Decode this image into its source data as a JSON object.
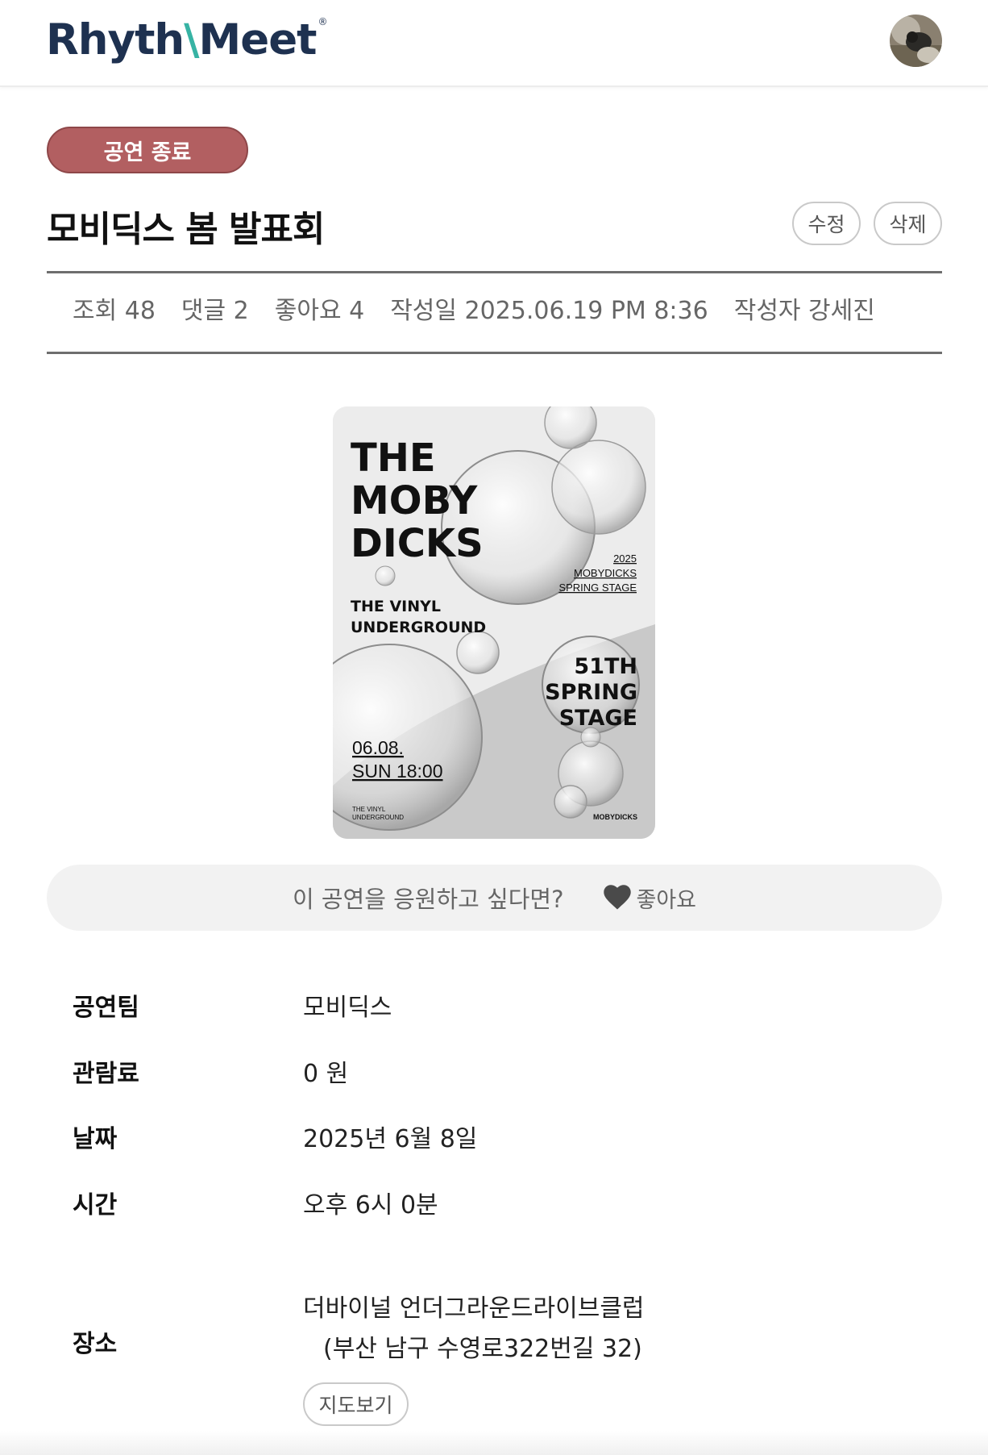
{
  "header": {
    "logo_main": "Rhyth",
    "logo_accent": "⨚",
    "logo_tail": "eet",
    "logo_reg": "®"
  },
  "post": {
    "status": "공연 종료",
    "title": "모비딕스 봄 발표회",
    "edit_label": "수정",
    "delete_label": "삭제",
    "meta": {
      "views": "조회 48",
      "comments": "댓글 2",
      "likes": "좋아요 4",
      "date": "작성일 2025.06.19 PM 8:36",
      "author": "작성자 강세진"
    }
  },
  "poster": {
    "title_line1": "THE",
    "title_line2": "MOBY",
    "title_line3": "DICKS",
    "sub_year": "2025",
    "sub_name": "MOBYDICKS",
    "sub_stage": "SPRING STAGE",
    "venue_line1": "THE VINYL",
    "venue_line2": "UNDERGROUND",
    "event_line1": "51TH",
    "event_line2": "SPRING",
    "event_line3": "STAGE",
    "date_line1": "06.08.",
    "date_line2": "SUN 18:00",
    "footer_left1": "THE VINYL",
    "footer_left2": "UNDERGROUND",
    "footer_right": "MOBYDICKS"
  },
  "like_bar": {
    "question": "이 공연을 응원하고 싶다면?",
    "button_label": "좋아요",
    "icon": "heart-icon"
  },
  "info": {
    "team_label": "공연팀",
    "team_value": "모비딕스",
    "fee_label": "관람료",
    "fee_value": "0 원",
    "date_label": "날짜",
    "date_value": "2025년 6월 8일",
    "time_label": "시간",
    "time_value": "오후 6시 0분",
    "place_label": "장소",
    "place_name": "더바이널 언더그라운드라이브클럽",
    "place_address": "(부산 남구 수영로322번길 32)",
    "map_button": "지도보기"
  },
  "colors": {
    "brand_navy": "#1e3150",
    "brand_teal": "#37b3a4",
    "status_badge": "#b25f61"
  }
}
